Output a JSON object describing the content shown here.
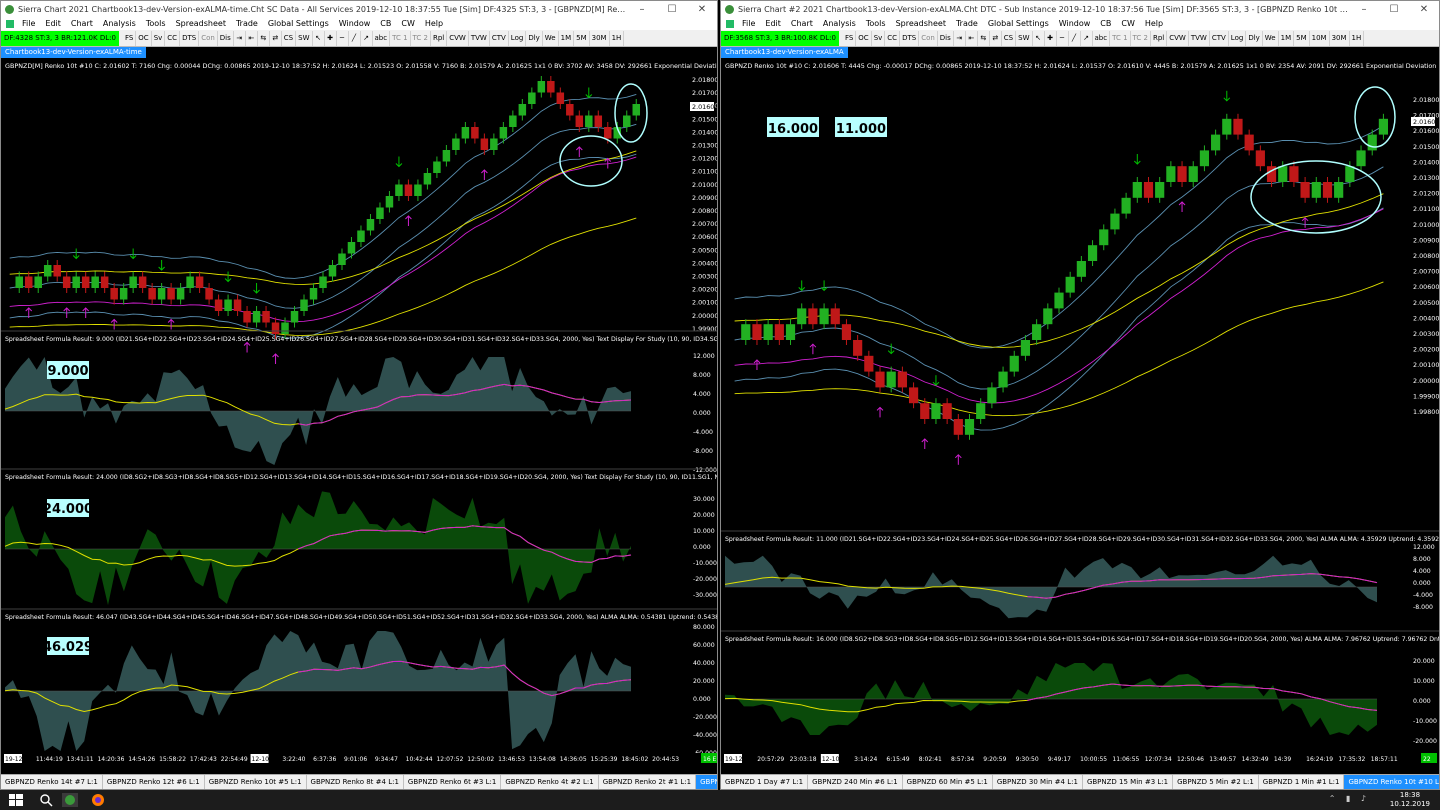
{
  "left": {
    "title": "Sierra Chart 2021 Chartbook13-dev-Version-exALMA-time.Cht  SC Data - All Services 2019-12-10  18:37:55 Tue [Sim]  DF:4325  ST:3, 3 - [GBPNZD[M]  Renko 10t  #1]",
    "menu": [
      "File",
      "Edit",
      "Chart",
      "Analysis",
      "Tools",
      "Spreadsheet",
      "Trade",
      "Global Settings",
      "Window",
      "CB",
      "CW",
      "Help"
    ],
    "status": "DF:4328  ST:3, 3  BR:121.0K  DL:0",
    "toolbar": [
      "FS",
      "OC",
      "Sv",
      "CC",
      "DTS",
      "Con",
      "Dis",
      "⇥",
      "⇤",
      "⇆",
      "⇄",
      "CS",
      "SW",
      "↖",
      "✚",
      "─",
      "╱",
      "↗",
      "abc",
      "TC 1",
      "TC 2",
      "Rpl",
      "CVW",
      "TVW",
      "CTV",
      "Log",
      "Dly",
      "We",
      "1M",
      "5M",
      "30M",
      "1H"
    ],
    "chartbook_tab": "Chartbook13-dev-Version-exALMA-time",
    "price_header": "GBPNZD[M]  Renko 10t  #10  C: 2.01602  T: 7160  Chg: 0.00044  DChg: 0.00865  2019-12-10 18:37:52  H: 2.01624  L: 2.01523  O: 2.01558  V: 7160  B: 2.01579  A: 2.01625  1x1 0  BV: 3702  AV: 3458  DV: 292661  Exponential Deviation Bands (Vitali Apirine)",
    "price_ticks": [
      "2.01800",
      "2.01700",
      "2.01600",
      "2.01500",
      "2.01400",
      "2.01300",
      "2.01200",
      "2.01100",
      "2.01000",
      "2.00900",
      "2.00800",
      "2.00700",
      "2.00600",
      "2.00500",
      "2.00400",
      "2.00300",
      "2.00200",
      "2.00100",
      "2.00000",
      "1.99900"
    ],
    "price_last": "2.01602",
    "panels": [
      {
        "header": "Spreadsheet Formula  Result: 9.000  (ID21.SG4+ID22.SG4+ID23.SG4+ID24.SG4+ID25.SG4+ID26.SG4+ID27.SG4+ID28.SG4+ID29.SG4+ID30.SG4+ID31.SG4+ID32.SG4+ID33.SG4, 2000, Yes)  Text Display For Study  (10, 90, ID34.SG1, 0, , , ,",
        "badge": "9.000",
        "ticks": [
          "12.000",
          "8.000",
          "4.000",
          "0.000",
          "-4.000",
          "-8.000",
          "-12.000"
        ]
      },
      {
        "header": "Spreadsheet Formula  Result: 24.000  (ID8.SG2+ID8.SG3+ID8.SG4+ID8.SG5+ID12.SG4+ID13.SG4+ID14.SG4+ID15.SG4+ID16.SG4+ID17.SG4+ID18.SG4+ID19.SG4+ID20.SG4, 2000, Yes)  Text Display For Study  (10, 90, ID11.SG1, No, 0, , No,",
        "badge": "24.000",
        "ticks": [
          "30.000",
          "20.000",
          "10.000",
          "0.000",
          "-10.000",
          "-20.000",
          "-30.000"
        ]
      },
      {
        "header": "Spreadsheet Formula  Result: 46.047  (ID43.SG4+ID44.SG4+ID45.SG4+ID46.SG4+ID47.SG4+ID48.SG4+ID49.SG4+ID50.SG4+ID51.SG4+ID52.SG4+ID31.SG4+ID32.SG4+ID33.SG4, 2000, Yes)  ALMA  ALMA: 0.54381  Uptrend: 0.54381  Dntrend:",
        "badge": "46.029",
        "ticks": [
          "80.000",
          "60.000",
          "40.000",
          "20.000",
          "0.000",
          "-20.000",
          "-40.000",
          "-60.000"
        ]
      }
    ],
    "time_labels": [
      "19-12-9",
      "11:44:19",
      "13:41:11",
      "14:20:36",
      "14:54:26",
      "15:58:22",
      "17:42:43",
      "22:54:49",
      "12-10",
      "3:22:40",
      "6:37:36",
      "9:01:06",
      "9:34:47",
      "10:42:44",
      "12:07:52",
      "12:50:02",
      "13:46:53",
      "13:54:08",
      "14:36:05",
      "15:25:39",
      "18:45:02",
      "20:44:53"
    ],
    "corner_tag": "16 E",
    "bottom_tabs": [
      "GBPNZD  Renko 14t  #7  L:1",
      "GBPNZD  Renko 12t  #6  L:1",
      "GBPNZD  Renko 10t  #5  L:1",
      "GBPNZD  Renko 8t  #4  L:1",
      "GBPNZD  Renko 6t  #3  L:1",
      "GBPNZD  Renko 4t  #2  L:1",
      "GBPNZD  Renko 2t  #1  L:1",
      "GBPNZD  Renko 10t  #10  L:1"
    ]
  },
  "right": {
    "title": "Sierra Chart #2 2021 Chartbook13-dev-Version-exALMA.Cht  DTC - Sub Instance 2019-12-10  18:37:56 Tue [Sim]  DF:3565  ST:3, 3 - [GBPNZD  Renko 10t  #10  L:1 | ]",
    "menu": [
      "File",
      "Edit",
      "Chart",
      "Analysis",
      "Tools",
      "Spreadsheet",
      "Trade",
      "Global Settings",
      "Window",
      "CB",
      "CW",
      "Help"
    ],
    "status": "DF:3568  ST:3, 3  BR:100.8K  DL:0",
    "toolbar": [
      "FS",
      "OC",
      "Sv",
      "CC",
      "DTS",
      "Con",
      "Dis",
      "⇥",
      "⇤",
      "⇆",
      "⇄",
      "CS",
      "SW",
      "↖",
      "✚",
      "─",
      "╱",
      "↗",
      "abc",
      "TC 1",
      "TC 2",
      "Rpl",
      "CVW",
      "TVW",
      "CTV",
      "Log",
      "Dly",
      "We",
      "1M",
      "5M",
      "10M",
      "30M",
      "1H"
    ],
    "chartbook_tab": "Chartbook13-dev-Version-exALMA",
    "price_header": "GBPNZD  Renko 10t  #10  C: 2.01606  T: 4445  Chg: -0.00017  DChg: 0.00865  2019-12-10 18:37:52  H: 2.01624  L: 2.01537  O: 2.01610  V: 4445  B: 2.01579  A: 2.01625  1x1 0  BV: 2354  AV: 2091  DV: 292661  Exponential Deviation Bands (Vitali Apirine)",
    "price_ticks": [
      "2.01800",
      "2.01700",
      "2.01600",
      "2.01500",
      "2.01400",
      "2.01300",
      "2.01200",
      "2.01100",
      "2.01000",
      "2.00900",
      "2.00800",
      "2.00700",
      "2.00600",
      "2.00500",
      "2.00400",
      "2.00300",
      "2.00200",
      "2.00100",
      "2.00000",
      "1.99900",
      "1.99800"
    ],
    "price_last": "2.01602",
    "badges": [
      "16.000",
      "11.000"
    ],
    "panels": [
      {
        "header": "Spreadsheet Formula  Result: 11.000  (ID21.SG4+ID22.SG4+ID23.SG4+ID24.SG4+ID25.SG4+ID26.SG4+ID27.SG4+ID28.SG4+ID29.SG4+ID30.SG4+ID31.SG4+ID32.SG4+ID33.SG4, 2000, Yes)  ALMA  ALMA: 4.35929  Uptrend: 4.35929  Dntrend: 0.0",
        "ticks": [
          "12.000",
          "8.000",
          "4.000",
          "0.000",
          "-4.000",
          "-8.000"
        ]
      },
      {
        "header": "Spreadsheet Formula  Result: 16.000  (ID8.SG2+ID8.SG3+ID8.SG4+ID8.SG5+ID12.SG4+ID13.SG4+ID14.SG4+ID15.SG4+ID16.SG4+ID17.SG4+ID18.SG4+ID19.SG4+ID20.SG4, 2000, Yes)  ALMA  ALMA: 7.96762  Uptrend: 7.96762  Dntrend: 0.0",
        "ticks": [
          "20.000",
          "10.000",
          "0.000",
          "-10.000",
          "-20.000"
        ]
      }
    ],
    "time_labels": [
      "19-12-9",
      "20:57:29",
      "23:03:18",
      "12-10",
      "3:14:24",
      "6:15:49",
      "8:02:41",
      "8:57:34",
      "9:20:59",
      "9:30:50",
      "9:49:17",
      "10:00:55",
      "11:06:55",
      "12:07:34",
      "12:50:46",
      "13:49:57",
      "14:32:49",
      "14:39",
      "16:24:19",
      "17:35:32",
      "18:57:11"
    ],
    "corner_tag": "22",
    "bottom_tabs": [
      "GBPNZD  1 Day  #7  L:1",
      "GBPNZD  240 Min  #6  L:1",
      "GBPNZD  60 Min  #5  L:1",
      "GBPNZD  30 Min  #4  L:1",
      "GBPNZD  15 Min  #3  L:1",
      "GBPNZD  5 Min  #2  L:1",
      "GBPNZD  1 Min  #1  L:1",
      "GBPNZD  Renko 10t  #10  L:1"
    ]
  },
  "taskbar": {
    "time": "18:38",
    "date": "10.12.2019"
  },
  "colors": {
    "up": "#22b022",
    "down": "#c01818",
    "bullArrow": "#00c000",
    "bearArrow": "#d020d0",
    "tick": "#ffffff",
    "badge": "#b8ffff",
    "area1": "#2f4f4f",
    "area2": "#0a4a0a",
    "yellow": "#e0e000",
    "magenta": "#d020d0",
    "ellipse": "#b0ffff"
  }
}
